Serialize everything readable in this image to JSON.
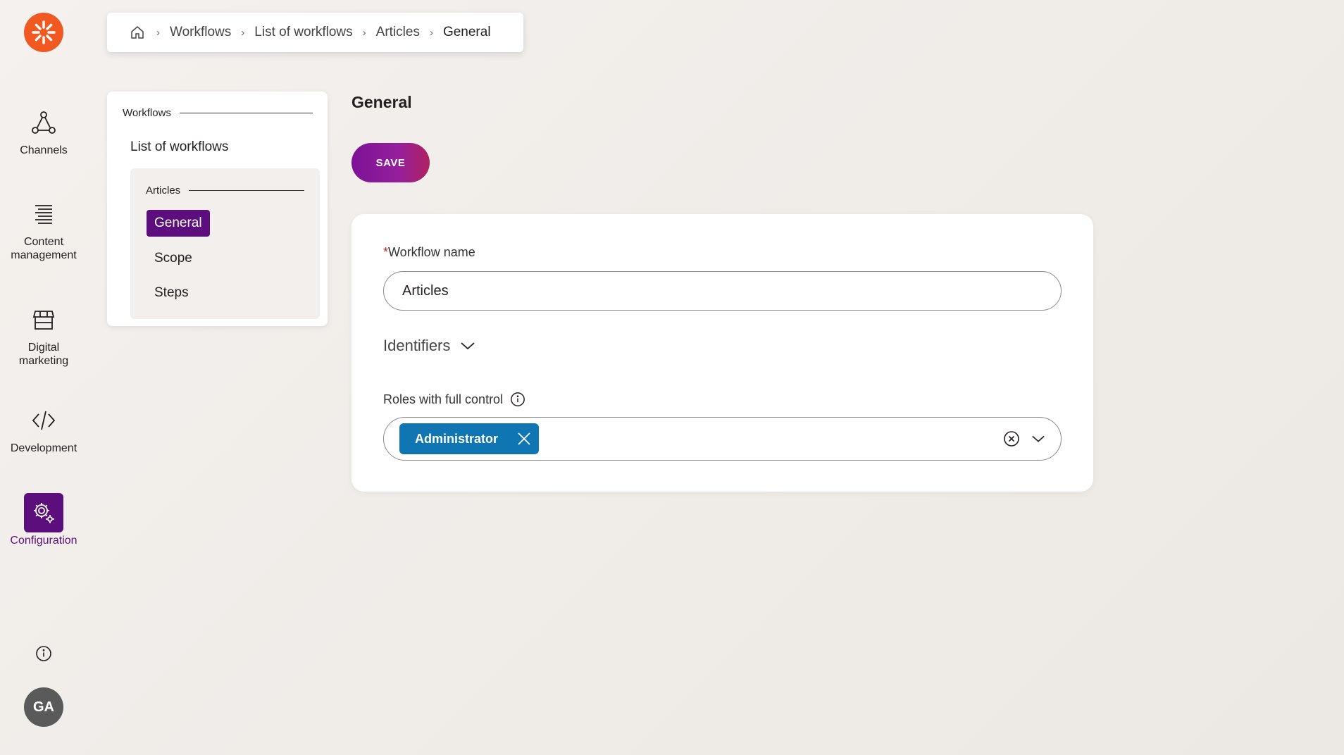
{
  "app_nav": {
    "items": [
      {
        "label": "Channels",
        "icon": "channels-icon"
      },
      {
        "label": "Content management",
        "icon": "content-management-icon"
      },
      {
        "label": "Digital marketing",
        "icon": "digital-marketing-icon"
      },
      {
        "label": "Development",
        "icon": "development-icon"
      },
      {
        "label": "Configuration",
        "icon": "gear-icon",
        "active": true
      }
    ],
    "avatar_initials": "GA",
    "accent_color": "#5b0e7c",
    "logo_color": "#f05a22"
  },
  "breadcrumb": {
    "items": [
      "Workflows",
      "List of workflows",
      "Articles",
      "General"
    ]
  },
  "subnav": {
    "group_label": "Workflows",
    "list_link": "List of workflows",
    "inner_group_label": "Articles",
    "items": [
      "General",
      "Scope",
      "Steps"
    ],
    "active_item": "General"
  },
  "main": {
    "title": "General",
    "save_label": "SAVE",
    "workflow_name": {
      "required_mark": "*",
      "label": "Workflow name",
      "value": "Articles"
    },
    "identifiers_label": "Identifiers",
    "roles": {
      "label": "Roles with full control",
      "selected": [
        "Administrator"
      ],
      "tag_color": "#0f76b3"
    }
  }
}
